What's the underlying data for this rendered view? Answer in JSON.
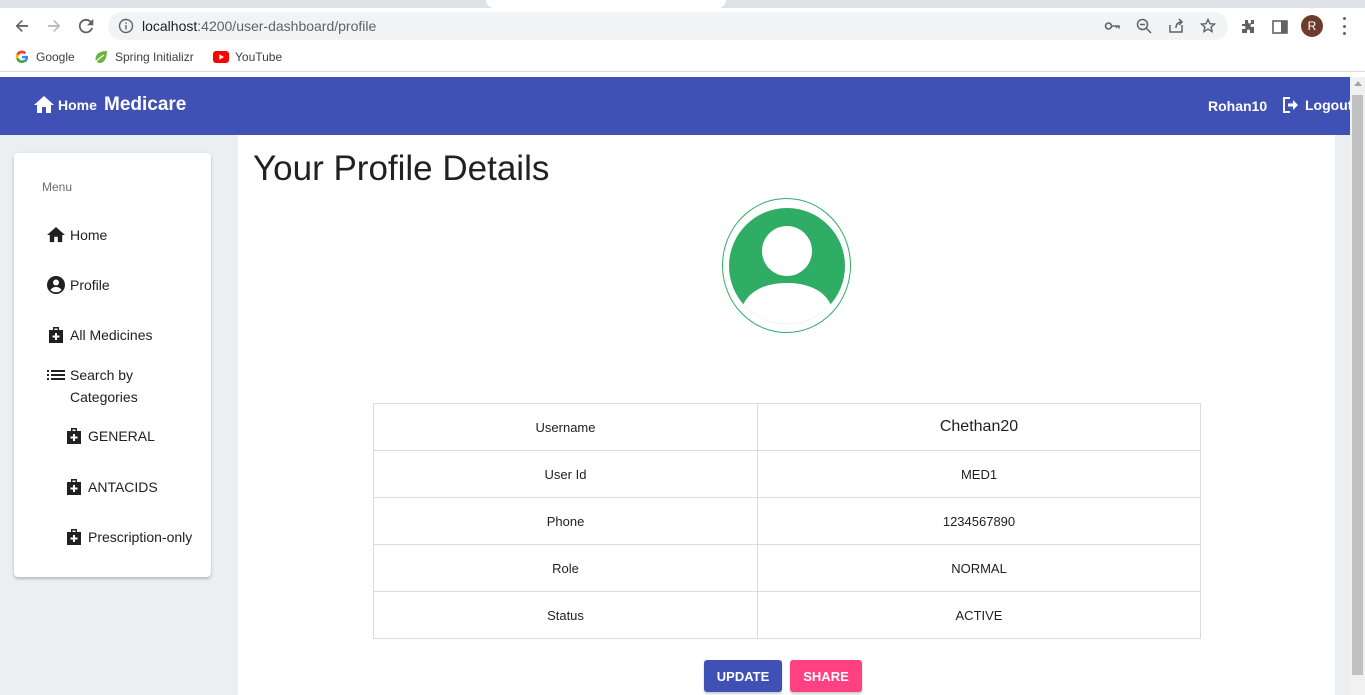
{
  "browser": {
    "url_host": "localhost",
    "url_path": ":4200/user-dashboard/profile",
    "avatar_letter": "R",
    "bookmarks": [
      {
        "label": "Google",
        "icon": "google-icon"
      },
      {
        "label": "Spring Initializr",
        "icon": "spring-icon"
      },
      {
        "label": "YouTube",
        "icon": "youtube-icon"
      }
    ]
  },
  "appbar": {
    "home_label": "Home",
    "brand": "Medicare",
    "username": "Rohan10",
    "logout_label": "Logout",
    "color": "#3f51b5"
  },
  "sidebar": {
    "title": "Menu",
    "items": [
      {
        "label": "Home",
        "icon": "home-icon"
      },
      {
        "label": "Profile",
        "icon": "account-circle-icon"
      },
      {
        "label": "All Medicines",
        "icon": "medical-bag-icon"
      },
      {
        "label": "Search by Categories",
        "icon": "list-icon"
      }
    ],
    "categories": [
      {
        "label": "GENERAL",
        "icon": "medical-bag-icon"
      },
      {
        "label": "ANTACIDS",
        "icon": "medical-bag-icon"
      },
      {
        "label": "Prescription-only",
        "icon": "medical-bag-icon"
      }
    ]
  },
  "main": {
    "title": "Your Profile Details",
    "profile_icon": "user-avatar-icon",
    "details": [
      {
        "key": "Username",
        "value": "Chethan20"
      },
      {
        "key": "User Id",
        "value": "MED1"
      },
      {
        "key": "Phone",
        "value": "1234567890"
      },
      {
        "key": "Role",
        "value": "NORMAL"
      },
      {
        "key": "Status",
        "value": "ACTIVE"
      }
    ],
    "update_label": "UPDATE",
    "share_label": "SHARE",
    "update_color": "#3f51b5",
    "share_color": "#ff4081"
  }
}
